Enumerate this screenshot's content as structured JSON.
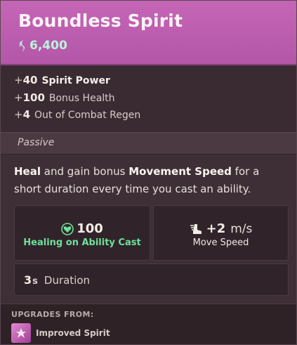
{
  "item": {
    "title": "Boundless Spirit",
    "price": "6,400",
    "price_icon": "soul-currency-icon",
    "header_color": "#c565b6"
  },
  "stats": [
    {
      "sign": "+",
      "value": "40",
      "label": "Spirit Power"
    },
    {
      "sign": "+",
      "value": "100",
      "label": "Bonus Health"
    },
    {
      "sign": "+",
      "value": "4",
      "label": "Out of Combat Regen"
    }
  ],
  "passive": {
    "header": "Passive",
    "desc": {
      "bold1": "Heal",
      "mid1": " and gain bonus ",
      "bold2": "Movement Speed",
      "rest": " for a short duration every time you cast an ability."
    },
    "heal": {
      "icon": "heart-icon",
      "value": "100",
      "label": "Healing on Ability Cast",
      "color": "#6fe09a"
    },
    "speed": {
      "icon": "winged-boot-icon",
      "value": "+2",
      "unit": "m/s",
      "label": "Move Speed"
    },
    "duration": {
      "value": "3",
      "unit": "s",
      "label": "Duration"
    }
  },
  "upgrades": {
    "title": "UPGRADES FROM:",
    "items": [
      {
        "name": "Improved Spirit",
        "icon": "spirit-icon"
      }
    ]
  }
}
